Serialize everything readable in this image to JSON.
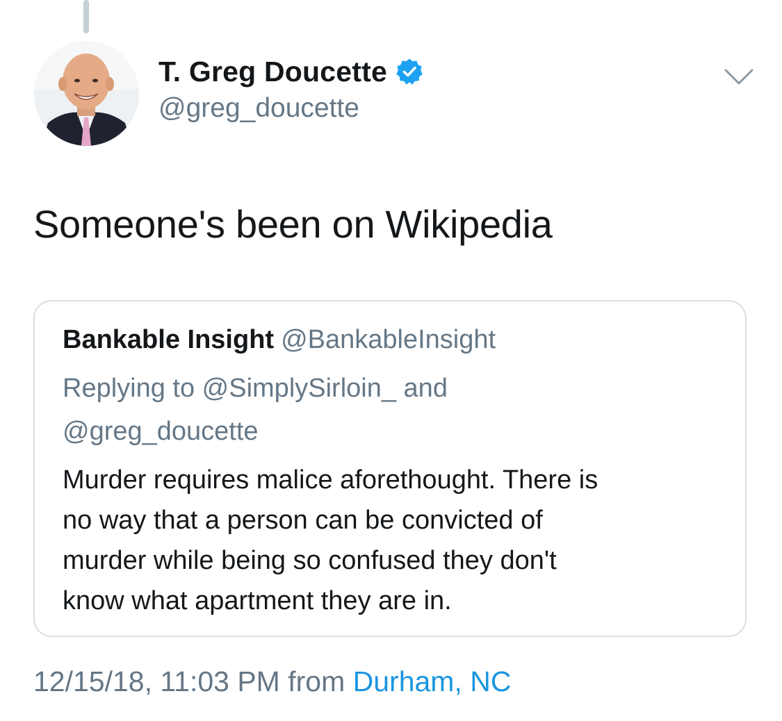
{
  "tweet": {
    "author": {
      "name": "T. Greg Doucette",
      "handle": "@greg_doucette",
      "verified": true
    },
    "text": "Someone's been on Wikipedia",
    "quoted_tweet": {
      "author_name": "Bankable Insight",
      "author_handle": "@BankableInsight",
      "reply_line_1": "Replying to @SimplySirloin_ and",
      "reply_line_2": "@greg_doucette",
      "body_lines": [
        "Murder requires malice aforethought. There is",
        "no way that a person can be convicted of",
        "murder while being so confused they don't",
        "know what apartment they are in."
      ]
    },
    "timestamp": "12/15/18, 11:03 PM",
    "from_label": "from",
    "location": "Durham, NC"
  },
  "icons": {
    "verified": "verified-badge-icon",
    "menu": "chevron-down-icon"
  },
  "colors": {
    "primary_text": "#14171a",
    "secondary_text": "#657786",
    "link": "#1b95e0",
    "verified_blue": "#1da1f2",
    "border": "#d8dee2",
    "thread_line": "#c4cfd6"
  }
}
